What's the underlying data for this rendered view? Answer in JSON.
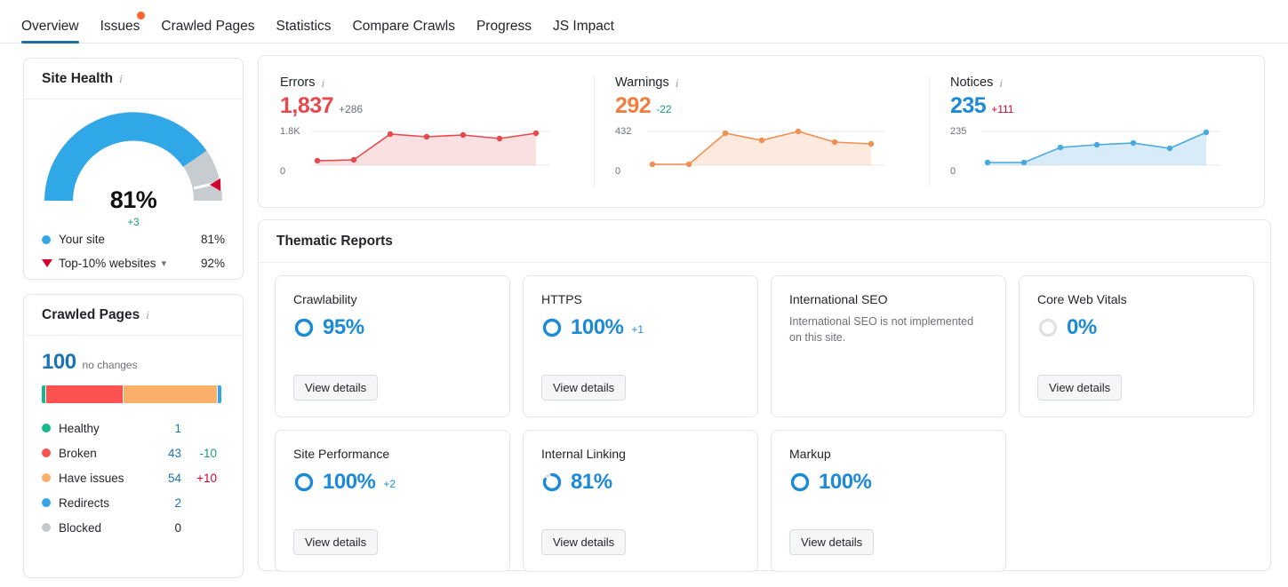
{
  "tabs": [
    {
      "label": "Overview",
      "active": true,
      "badge": false
    },
    {
      "label": "Issues",
      "active": false,
      "badge": true
    },
    {
      "label": "Crawled Pages",
      "active": false,
      "badge": false
    },
    {
      "label": "Statistics",
      "active": false,
      "badge": false
    },
    {
      "label": "Compare Crawls",
      "active": false,
      "badge": false
    },
    {
      "label": "Progress",
      "active": false,
      "badge": false
    },
    {
      "label": "JS Impact",
      "active": false,
      "badge": false
    }
  ],
  "site_health": {
    "title": "Site Health",
    "gauge_value": "81%",
    "gauge_delta": "+3",
    "gauge_percent": 81,
    "marker_percent": 92,
    "legend": [
      {
        "name": "Your site",
        "value": "81%",
        "marker": "dot",
        "color": "#30a8e8"
      },
      {
        "name": "Top-10% websites",
        "value": "92%",
        "marker": "triangle",
        "color": "#d6002e",
        "has_chevron": true
      }
    ]
  },
  "crawled_pages": {
    "title": "Crawled Pages",
    "total": "100",
    "change_text": "no changes",
    "bar_segments": [
      {
        "name": "Healthy",
        "percent": 1,
        "color": "#14b88a"
      },
      {
        "name": "Broken",
        "percent": 43,
        "color": "#fb5151"
      },
      {
        "name": "Have issues",
        "percent": 54,
        "color": "#fbb069"
      },
      {
        "name": "Redirects",
        "percent": 2,
        "color": "#34a4e6"
      }
    ],
    "legend": [
      {
        "name": "Healthy",
        "value": "1",
        "delta": "",
        "delta_sign": "",
        "color": "#14b88a"
      },
      {
        "name": "Broken",
        "value": "43",
        "delta": "-10",
        "delta_sign": "neg",
        "color": "#fb5151"
      },
      {
        "name": "Have issues",
        "value": "54",
        "delta": "+10",
        "delta_sign": "pos",
        "color": "#fbb069"
      },
      {
        "name": "Redirects",
        "value": "2",
        "delta": "",
        "delta_sign": "",
        "color": "#34a4e6"
      },
      {
        "name": "Blocked",
        "value": "0",
        "delta": "",
        "delta_sign": "",
        "color": "#c3c8cd"
      }
    ]
  },
  "stats": [
    {
      "label": "Errors",
      "value": "1,837",
      "delta": "+286",
      "delta_color": "#6b7178",
      "value_color": "#e5484d",
      "line_color": "#e5484d",
      "fill_color": "rgba(229,72,77,0.18)",
      "y_high": "1.8K",
      "y_low": "0",
      "points": [
        12,
        13,
        78,
        72,
        76,
        66,
        80
      ]
    },
    {
      "label": "Warnings",
      "value": "292",
      "delta": "-22",
      "delta_color": "#179b7f",
      "value_color": "#ef7f40",
      "line_color": "#ef8f52",
      "fill_color": "rgba(239,143,82,0.20)",
      "y_high": "432",
      "y_low": "0",
      "points": [
        2,
        2,
        75,
        62,
        79,
        58,
        52
      ]
    },
    {
      "label": "Notices",
      "value": "235",
      "delta": "+111",
      "delta_color": "#d6002e",
      "value_color": "#1d8ad6",
      "line_color": "#4aa8e0",
      "fill_color": "rgba(74,168,224,0.22)",
      "y_high": "235",
      "y_low": "0",
      "points": [
        5,
        5,
        47,
        55,
        60,
        45,
        96
      ]
    }
  ],
  "thematic": {
    "title": "Thematic Reports",
    "button_label": "View details",
    "cards": [
      {
        "name": "Crawlability",
        "percent": "95%",
        "percent_num": 95,
        "delta": "",
        "note": "",
        "has_button": true,
        "ring_color": "#1d8ad6"
      },
      {
        "name": "HTTPS",
        "percent": "100%",
        "percent_num": 100,
        "delta": "+1",
        "note": "",
        "has_button": true,
        "ring_color": "#1d8ad6"
      },
      {
        "name": "International SEO",
        "percent": "",
        "percent_num": 0,
        "delta": "",
        "note": "International SEO is not implemented on this site.",
        "has_button": false,
        "ring_color": ""
      },
      {
        "name": "Core Web Vitals",
        "percent": "0%",
        "percent_num": 0,
        "delta": "",
        "note": "",
        "has_button": true,
        "ring_color": "#d9dcdf"
      },
      {
        "name": "Site Performance",
        "percent": "100%",
        "percent_num": 100,
        "delta": "+2",
        "note": "",
        "has_button": true,
        "ring_color": "#1d8ad6"
      },
      {
        "name": "Internal Linking",
        "percent": "81%",
        "percent_num": 81,
        "delta": "",
        "note": "",
        "has_button": true,
        "ring_color": "#1d8ad6"
      },
      {
        "name": "Markup",
        "percent": "100%",
        "percent_num": 100,
        "delta": "",
        "note": "",
        "has_button": true,
        "ring_color": "#1d8ad6"
      }
    ]
  },
  "chart_data": [
    {
      "type": "area",
      "title": "Errors",
      "x": [
        1,
        2,
        3,
        4,
        5,
        6,
        7
      ],
      "values": [
        230,
        250,
        1700,
        1560,
        1640,
        1430,
        1837
      ],
      "ylim": [
        0,
        1800
      ],
      "ytick_labels": [
        "0",
        "1.8K"
      ],
      "xlabel": "",
      "ylabel": "",
      "grid": true,
      "legend": "none"
    },
    {
      "type": "area",
      "title": "Warnings",
      "x": [
        1,
        2,
        3,
        4,
        5,
        6,
        7
      ],
      "values": [
        8,
        8,
        400,
        330,
        420,
        310,
        292
      ],
      "ylim": [
        0,
        432
      ],
      "ytick_labels": [
        "0",
        "432"
      ],
      "xlabel": "",
      "ylabel": "",
      "grid": true,
      "legend": "none"
    },
    {
      "type": "area",
      "title": "Notices",
      "x": [
        1,
        2,
        3,
        4,
        5,
        6,
        7
      ],
      "values": [
        10,
        10,
        110,
        128,
        140,
        105,
        235
      ],
      "ylim": [
        0,
        235
      ],
      "ytick_labels": [
        "0",
        "235"
      ],
      "xlabel": "",
      "ylabel": "",
      "grid": true,
      "legend": "none"
    }
  ]
}
